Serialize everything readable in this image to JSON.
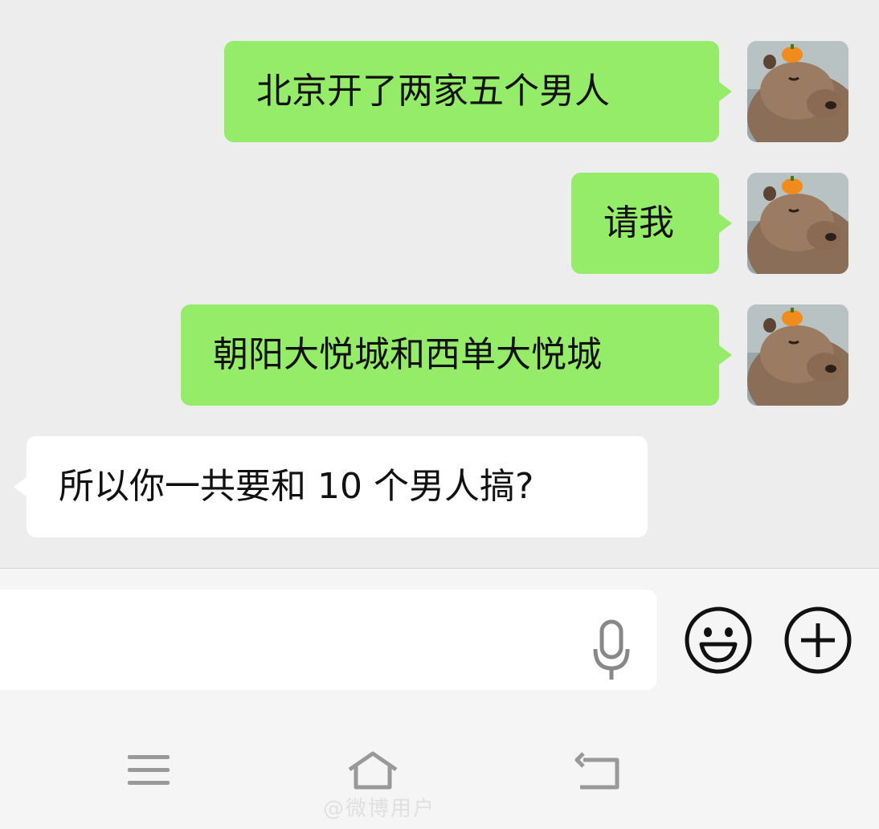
{
  "messages": [
    {
      "sender": "me",
      "text": "北京开了两家五个男人"
    },
    {
      "sender": "me",
      "text": "请我"
    },
    {
      "sender": "me",
      "text": "朝阳大悦城和西单大悦城"
    },
    {
      "sender": "other",
      "text": "所以你一共要和 10 个男人搞?"
    }
  ],
  "input": {
    "value": "",
    "placeholder": ""
  },
  "icons": {
    "avatar": "capybara-with-orange-avatar",
    "voice": "microphone-icon",
    "emoji": "smiley-icon",
    "more": "plus-circle-icon",
    "nav_menu": "menu-icon",
    "nav_home": "home-icon",
    "nav_back": "back-icon"
  },
  "watermark": "@微博用户",
  "colors": {
    "my_bubble": "#95ec69",
    "other_bubble": "#ffffff",
    "chat_background": "#ededed",
    "icon": "#111111"
  }
}
